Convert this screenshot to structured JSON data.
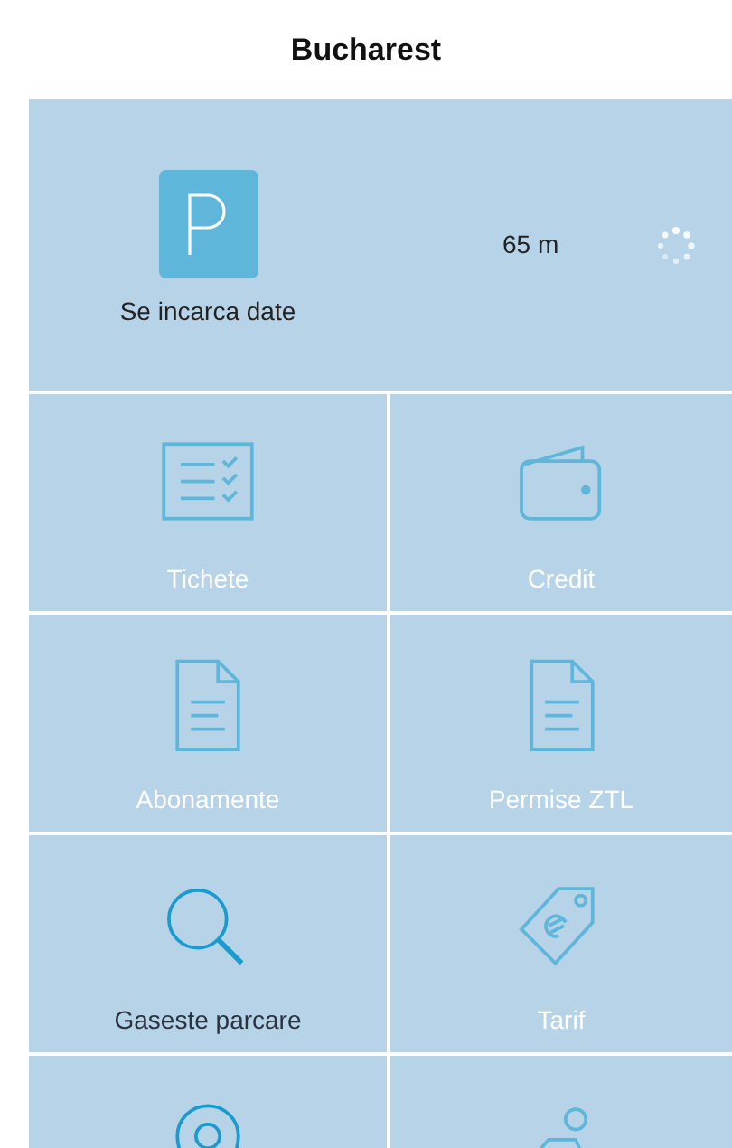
{
  "title": "Bucharest",
  "status": {
    "label": "Se incarca date",
    "distance": "65 m"
  },
  "tiles": [
    {
      "kind": "checklist",
      "label": "Tichete",
      "disabled": true
    },
    {
      "kind": "wallet",
      "label": "Credit",
      "disabled": true
    },
    {
      "kind": "document",
      "label": "Abonamente",
      "disabled": true
    },
    {
      "kind": "document",
      "label": "Permise ZTL",
      "disabled": true
    },
    {
      "kind": "search",
      "label": "Gaseste parcare",
      "disabled": false
    },
    {
      "kind": "tag",
      "label": "Tarif",
      "disabled": true
    },
    {
      "kind": "pin",
      "disabled": false
    },
    {
      "kind": "person",
      "disabled": true
    }
  ]
}
